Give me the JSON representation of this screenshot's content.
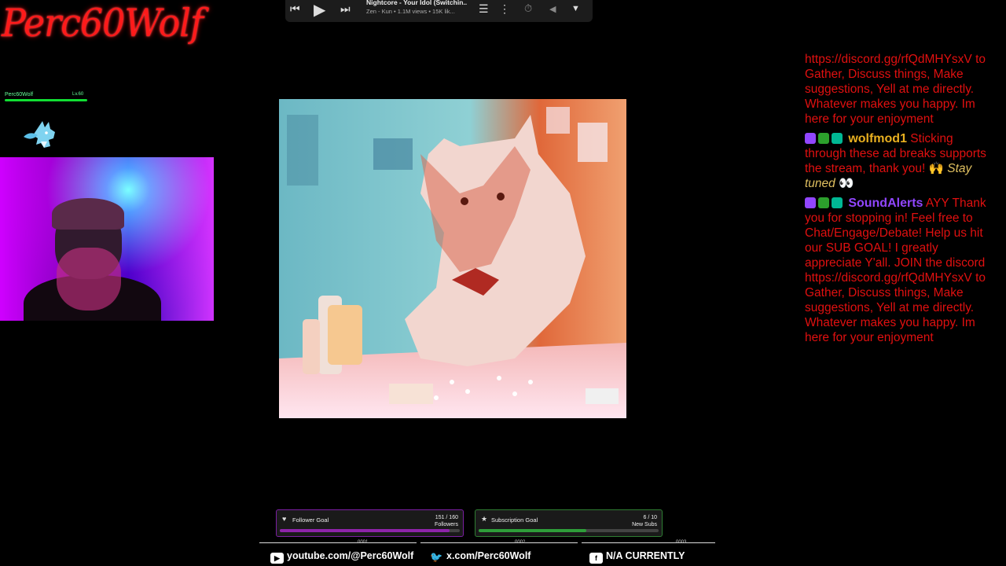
{
  "overlay": {
    "logo_text": "Perc60Wolf",
    "mini_name": "Perc60Wolf",
    "mini_value": "Lv.60"
  },
  "player": {
    "title": "Nightcore - Your Idol (Switchin...",
    "subtitle": "Zen - Kun • 1.1M views • 15K lik..."
  },
  "chat": {
    "messages": [
      {
        "text": "https://discord.gg/rfQdMHYsxV to Gather, Discuss things, Make suggestions, Yell at me directly. Whatever makes you happy. Im here for your enjoyment"
      },
      {
        "user": "wolfmod1",
        "user_color": "#e8b020",
        "text": "Sticking through these ad breaks supports the stream, thank you! 🙌",
        "tail": "Stay tuned",
        "emoji": "👀"
      },
      {
        "user": "SoundAlerts",
        "user_color": "#9146ff",
        "text": "AYY Thank you for stopping in! Feel free to Chat/Engage/Debate! Help us hit our SUB GOAL! I greatly appreciate Y'all. JOIN the discord https://discord.gg/rfQdMHYsxV to Gather, Discuss things, Make suggestions, Yell at me directly. Whatever makes you happy. Im here for your enjoyment"
      }
    ]
  },
  "goals": {
    "follower": {
      "label": "Follower Goal",
      "count": "151 / 160",
      "unit": "Followers",
      "progress": 0.944,
      "color": "#8e24aa"
    },
    "subscription": {
      "label": "Subscription Goal",
      "count": "6 / 10",
      "unit": "New Subs",
      "progress": 0.6,
      "color": "#2e9e3a"
    }
  },
  "socials": {
    "youtube": "youtube.com/@Perc60Wolf",
    "x": "x.com/Perc60Wolf",
    "facebook": "N/A CURRENTLY",
    "seg1": "0001",
    "seg2": "0002",
    "seg3": "0003"
  },
  "icons": {
    "prev": "skip-previous-icon",
    "play": "play-icon",
    "next": "skip-next-icon",
    "queue": "queue-icon",
    "more": "more-vert-icon",
    "timer": "timer-icon",
    "back": "back-icon",
    "collapse": "chevron-down-icon"
  }
}
